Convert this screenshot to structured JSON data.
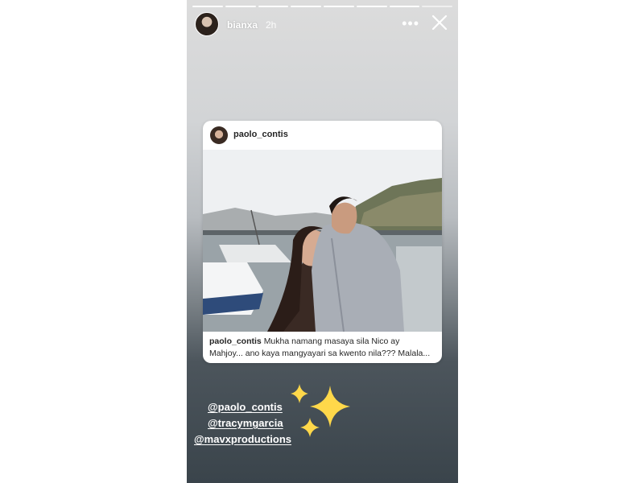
{
  "story": {
    "username": "bianxa",
    "time_ago": "2h",
    "more_icon": "more-horizontal-icon",
    "close_icon": "close-icon"
  },
  "shared_post": {
    "username": "paolo_contis",
    "caption_username": "paolo_contis",
    "caption_text": "Mukha namang masaya sila Nico ay Mahjoy... ano kaya mangyayari sa kwento nila??? Malala..."
  },
  "mentions": [
    "@paolo_contis",
    "@tracymgarcia",
    "@mavxproductions"
  ],
  "colors": {
    "sparkle": "#ffd84a",
    "text_on_story": "#ffffff"
  }
}
